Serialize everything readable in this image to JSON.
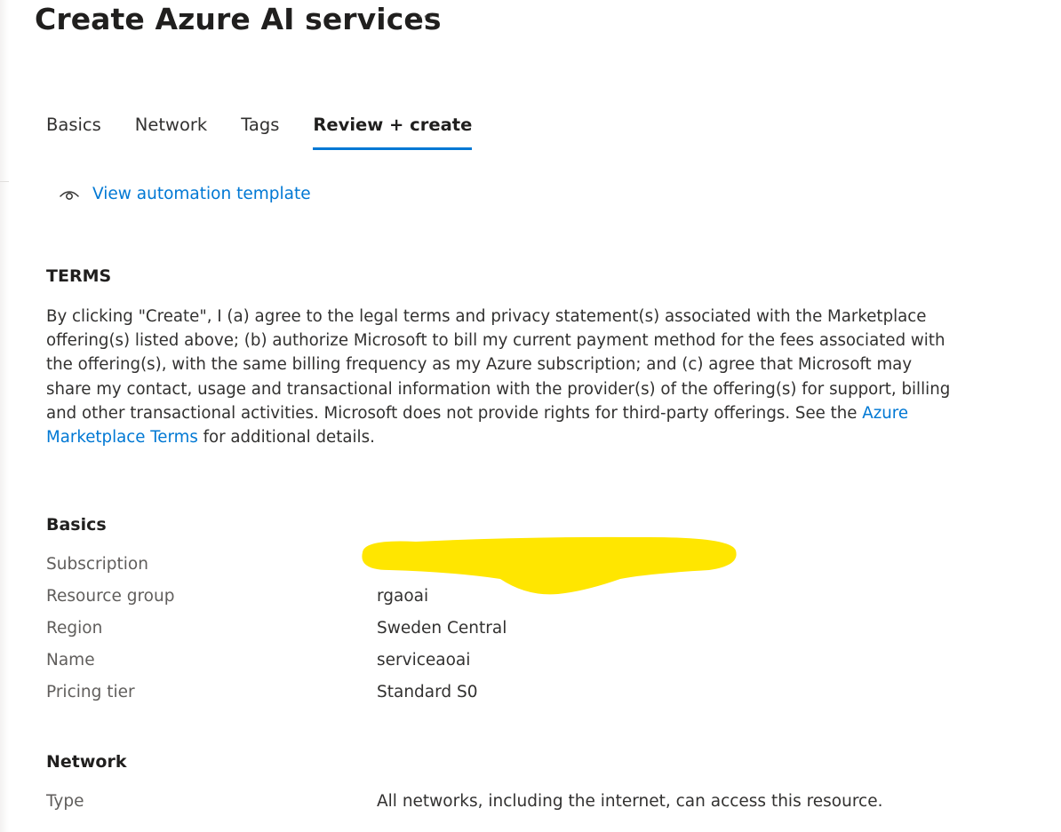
{
  "header": {
    "title": "Create Azure AI services",
    "more_label": "···"
  },
  "tabs": [
    {
      "label": "Basics",
      "active": false
    },
    {
      "label": "Network",
      "active": false
    },
    {
      "label": "Tags",
      "active": false
    },
    {
      "label": "Review + create",
      "active": true
    }
  ],
  "automation": {
    "link_label": "View automation template",
    "icon": "eye-icon"
  },
  "terms": {
    "heading": "TERMS",
    "text_before_link": "By clicking \"Create\", I (a) agree to the legal terms and privacy statement(s) associated with the Marketplace offering(s) listed above; (b) authorize Microsoft to bill my current payment method for the fees associated with the offering(s), with the same billing frequency as my Azure subscription; and (c) agree that Microsoft may share my contact, usage and transactional information with the provider(s) of the offering(s) for support, billing and other transactional activities. Microsoft does not provide rights for third-party offerings. See the ",
    "link_label": "Azure Marketplace Terms",
    "text_after_link": " for additional details."
  },
  "basics": {
    "heading": "Basics",
    "rows": [
      {
        "label": "Subscription",
        "value": ""
      },
      {
        "label": "Resource group",
        "value": "rgaoai"
      },
      {
        "label": "Region",
        "value": "Sweden Central"
      },
      {
        "label": "Name",
        "value": "serviceaoai"
      },
      {
        "label": "Pricing tier",
        "value": "Standard S0"
      }
    ]
  },
  "network": {
    "heading": "Network",
    "rows": [
      {
        "label": "Type",
        "value": "All networks, including the internet, can access this resource."
      }
    ]
  },
  "colors": {
    "accent": "#0078d4",
    "redaction": "#ffe600"
  }
}
